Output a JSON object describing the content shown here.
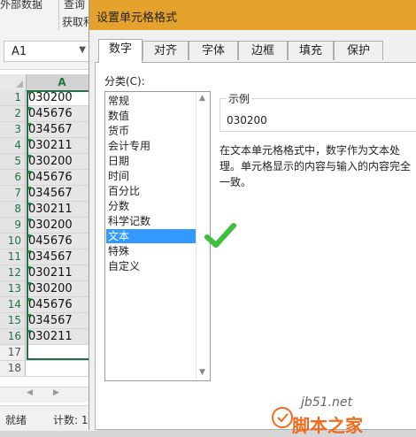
{
  "excel": {
    "ribbon": {
      "tab_partial": "外部数据",
      "query_partial": "查询",
      "group_partial": "获取和"
    },
    "name_box": "A1",
    "column_header": "A",
    "rows": [
      {
        "num": "1",
        "value": "030200"
      },
      {
        "num": "2",
        "value": "045676"
      },
      {
        "num": "3",
        "value": "034567"
      },
      {
        "num": "4",
        "value": "030211"
      },
      {
        "num": "5",
        "value": "030200"
      },
      {
        "num": "6",
        "value": "045676"
      },
      {
        "num": "7",
        "value": "034567"
      },
      {
        "num": "8",
        "value": "030211"
      },
      {
        "num": "9",
        "value": "030200"
      },
      {
        "num": "10",
        "value": "045676"
      },
      {
        "num": "11",
        "value": "034567"
      },
      {
        "num": "12",
        "value": "030211"
      },
      {
        "num": "13",
        "value": "030200"
      },
      {
        "num": "14",
        "value": "045676"
      },
      {
        "num": "15",
        "value": "034567"
      },
      {
        "num": "16",
        "value": "030211"
      },
      {
        "num": "17",
        "value": ""
      },
      {
        "num": "18",
        "value": ""
      }
    ],
    "status": {
      "ready": "就绪",
      "count": "计数: 1"
    }
  },
  "dialog": {
    "title": "设置单元格格式",
    "tabs": [
      "数字",
      "对齐",
      "字体",
      "边框",
      "填充",
      "保护"
    ],
    "category_label": "分类(C):",
    "categories": [
      "常规",
      "数值",
      "货币",
      "会计专用",
      "日期",
      "时间",
      "百分比",
      "分数",
      "科学记数",
      "文本",
      "特殊",
      "自定义"
    ],
    "selected_category": "文本",
    "sample_label": "示例",
    "sample_value": "030200",
    "description": "在文本单元格格式中，数字作为文本处理。单元格显示的内容与输入的内容完全一致。"
  },
  "watermark": {
    "site": "jb51.net",
    "brand": "脚本之家"
  },
  "colors": {
    "title_bar": "#e4a12c",
    "selection": "#3399ff",
    "excel_green": "#217346",
    "check": "#3dbf3d"
  }
}
